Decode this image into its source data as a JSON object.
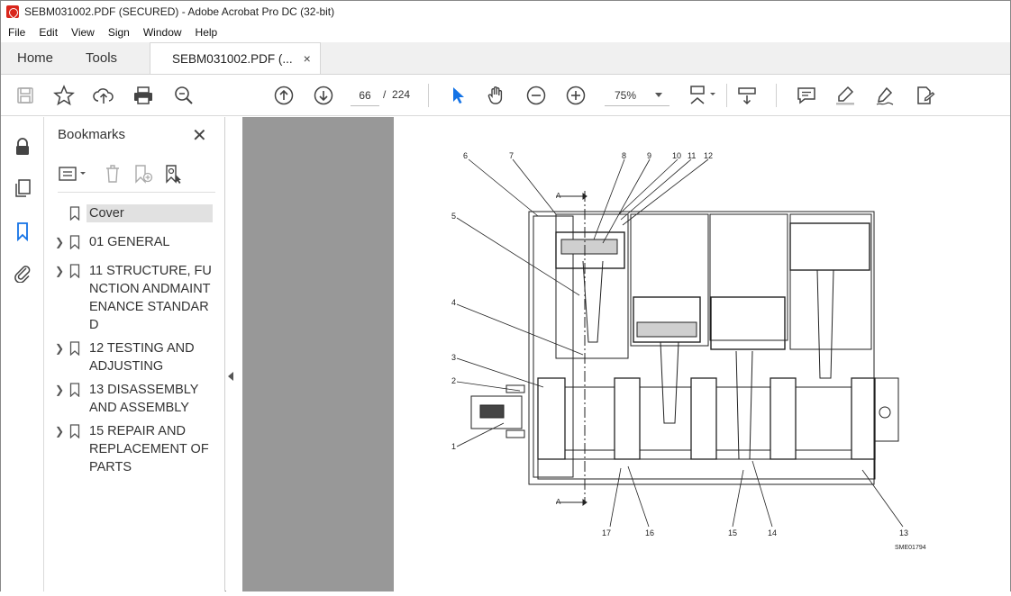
{
  "window": {
    "title": "SEBM031002.PDF (SECURED) - Adobe Acrobat Pro DC (32-bit)"
  },
  "menu": [
    "File",
    "Edit",
    "View",
    "Sign",
    "Window",
    "Help"
  ],
  "tabs": {
    "home": "Home",
    "tools": "Tools",
    "document": "SEBM031002.PDF (...",
    "close": "×"
  },
  "toolbar": {
    "page_current": "66",
    "page_sep": "/",
    "page_total": "224",
    "zoom": "75%",
    "icons": [
      "save-icon",
      "bookmark-star-icon",
      "upload-icon",
      "print-icon",
      "zoom-search-icon",
      "previous-page-icon",
      "next-page-icon",
      "select-cursor-icon",
      "hand-icon",
      "zoom-out-icon",
      "zoom-in-icon",
      "fit-page-icon",
      "scroll-mode-icon",
      "comment-icon",
      "highlight-icon",
      "sign-icon",
      "more-tools-icon"
    ]
  },
  "leftrail": {
    "icons": [
      "lock-icon",
      "pages-icon",
      "bookmarks-icon",
      "attachments-icon"
    ]
  },
  "bookmarks": {
    "title": "Bookmarks",
    "close": "✕",
    "items": [
      {
        "label": "Cover",
        "expandable": false,
        "selected": true
      },
      {
        "label": "01 GENERAL",
        "expandable": true
      },
      {
        "label": "11 STRUCTURE, FUNCTION ANDMAINTENANCE STANDARD",
        "expandable": true
      },
      {
        "label": "12 TESTING AND ADJUSTING",
        "expandable": true
      },
      {
        "label": "13 DISASSEMBLY AND ASSEMBLY",
        "expandable": true
      },
      {
        "label": "15 REPAIR AND REPLACEMENT OF PARTS",
        "expandable": true
      }
    ]
  },
  "drawing": {
    "callouts_top": [
      "6",
      "7",
      "8",
      "9",
      "10",
      "11",
      "12"
    ],
    "callouts_left": [
      "5",
      "4",
      "3",
      "2",
      "1"
    ],
    "callouts_bottom": [
      "17",
      "16",
      "15",
      "14",
      "13"
    ],
    "section_marker": "A",
    "drawing_code": "SME01794"
  }
}
